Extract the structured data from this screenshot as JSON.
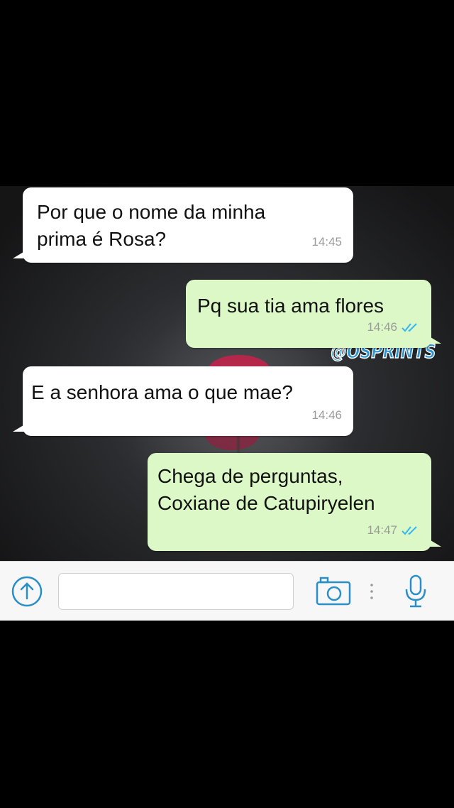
{
  "chat": {
    "watermark": "@OSPRINTS",
    "messages": [
      {
        "direction": "incoming",
        "text": "Por que o nome da minha\nprima é Rosa?",
        "time": "14:45"
      },
      {
        "direction": "outgoing",
        "text": "Pq sua tia ama flores",
        "time": "14:46",
        "status": "read"
      },
      {
        "direction": "incoming",
        "text": "E a senhora ama o que mae?",
        "time": "14:46"
      },
      {
        "direction": "outgoing",
        "text": "Chega de perguntas,\nCoxiane de Catupiryelen",
        "time": "14:47",
        "status": "read"
      }
    ]
  },
  "input_bar": {
    "upload_icon": "upload-icon",
    "message_value": "",
    "camera_icon": "camera-icon",
    "more_icon": "more-dots-icon",
    "mic_icon": "microphone-icon"
  },
  "colors": {
    "incoming_bubble": "#ffffff",
    "outgoing_bubble": "#dcf8c6",
    "read_ticks": "#34b7f1",
    "icon_accent": "#2a8fc7",
    "watermark": "#2c93cf"
  }
}
